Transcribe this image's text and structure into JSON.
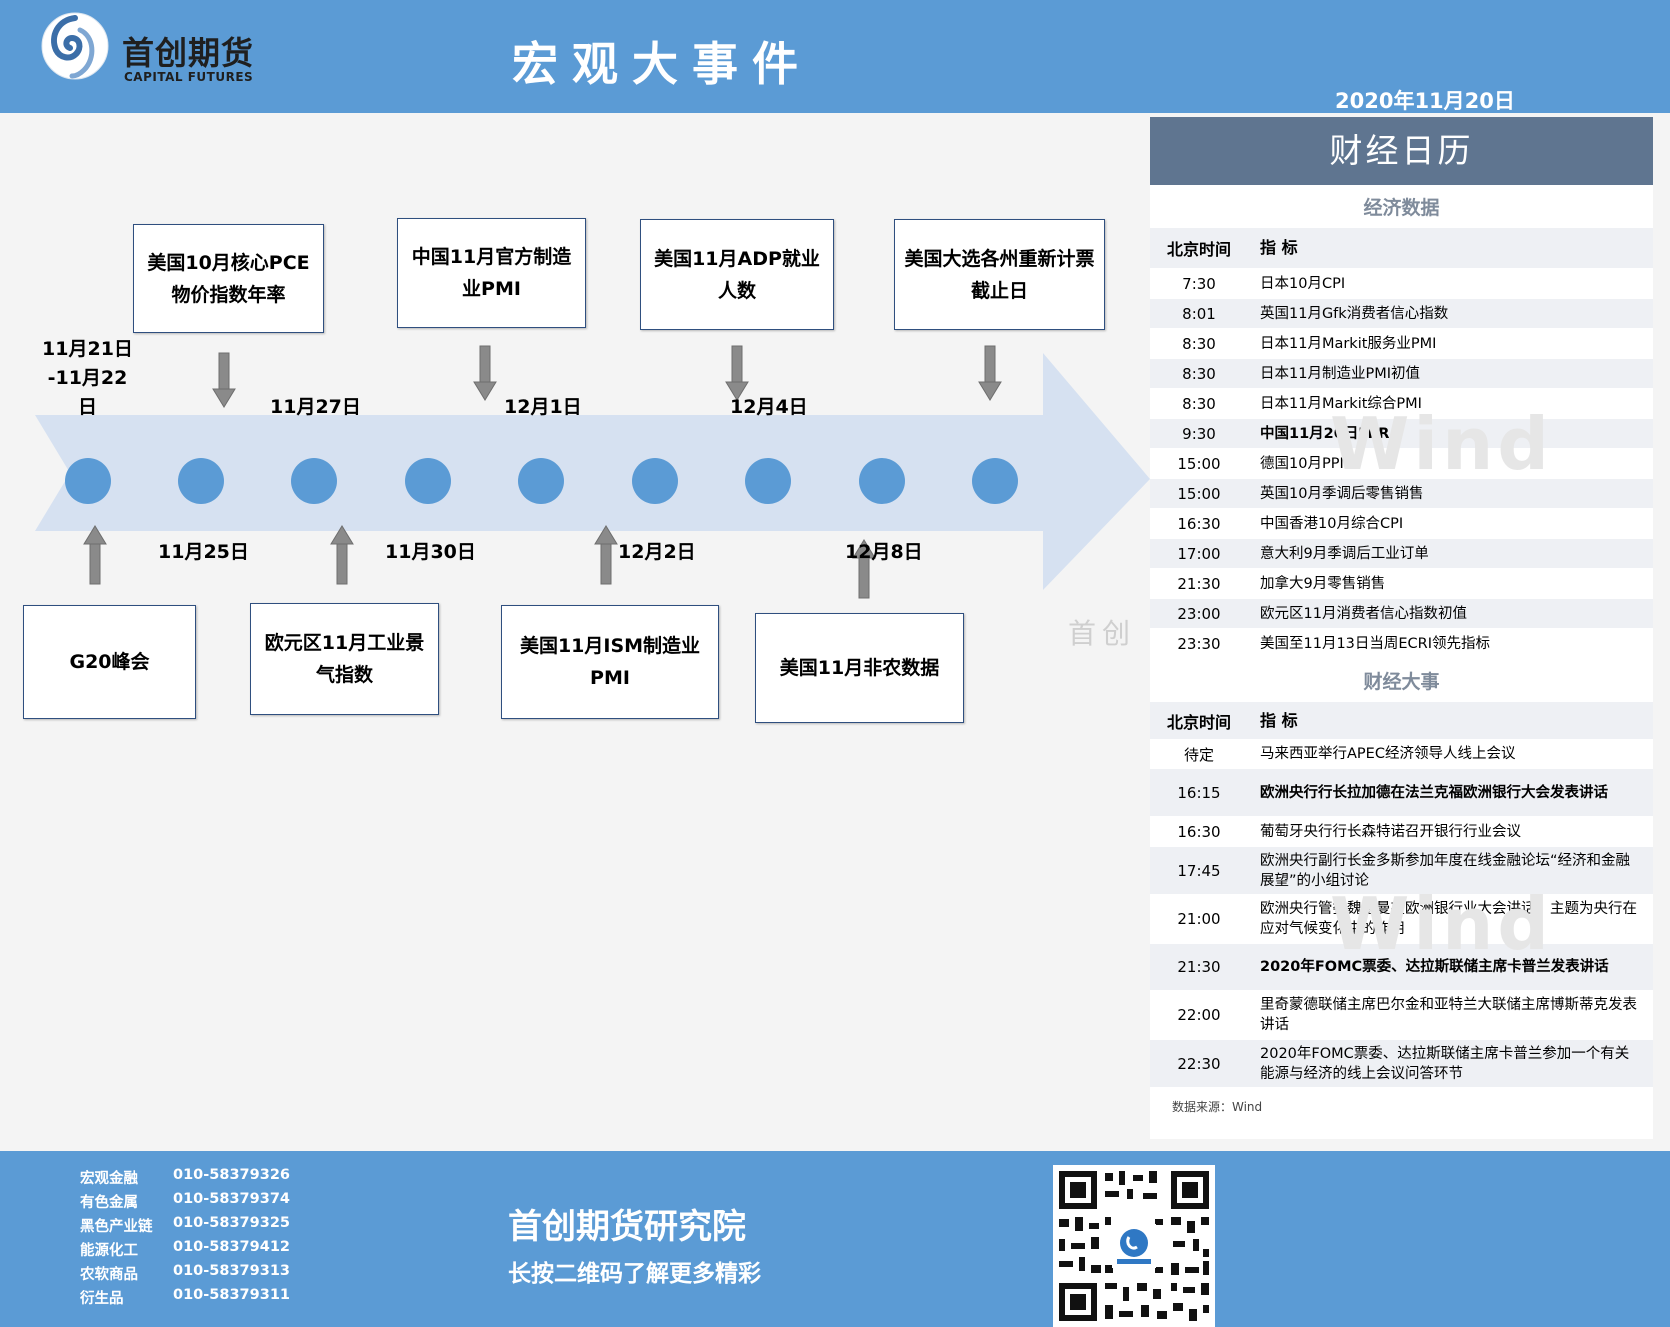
{
  "header": {
    "logo_cn": "首创期货",
    "logo_en": "CAPITAL FUTURES",
    "title": "宏观大事件",
    "date": "2020年11月20日"
  },
  "timeline": {
    "top_events": [
      {
        "l1": "美国10月核心PCE",
        "l2": "物价指数年率"
      },
      {
        "l1": "中国11月官方制造",
        "l2": "业PMI"
      },
      {
        "l1": "美国11月ADP就业",
        "l2": "人数"
      },
      {
        "l1": "美国大选各州重新计票",
        "l2": "截止日"
      }
    ],
    "bottom_events": [
      {
        "l1": "G20峰会",
        "l2": ""
      },
      {
        "l1": "欧元区11月工业景",
        "l2": "气指数"
      },
      {
        "l1": "美国11月ISM制造业",
        "l2": "PMI"
      },
      {
        "l1": "美国11月非农数据",
        "l2": ""
      }
    ],
    "first_date": {
      "l1": "11月21日",
      "l2": "-11月22",
      "l3": "日"
    },
    "top_dates": [
      "11月27日",
      "12月1日",
      "12月4日"
    ],
    "bottom_dates": [
      "11月25日",
      "11月30日",
      "12月2日",
      "12月8日"
    ]
  },
  "watermark": {
    "cn": "首创",
    "wind": "Wind"
  },
  "calendar": {
    "title": "财经日历",
    "econ_title": "经济数据",
    "events_title": "财经大事",
    "col_time": "北京时间",
    "col_indicator": "指  标",
    "econ_rows": [
      {
        "time": "7:30",
        "ind": "日本10月CPI"
      },
      {
        "time": "8:01",
        "ind": "英国11月Gfk消费者信心指数"
      },
      {
        "time": "8:30",
        "ind": "日本11月Markit服务业PMI"
      },
      {
        "time": "8:30",
        "ind": "日本11月制造业PMI初值"
      },
      {
        "time": "8:30",
        "ind": "日本11月Markit综合PMI"
      },
      {
        "time": "9:30",
        "ind": "中国11月20日LPR"
      },
      {
        "time": "15:00",
        "ind": "德国10月PPI"
      },
      {
        "time": "15:00",
        "ind": "英国10月季调后零售销售"
      },
      {
        "time": "16:30",
        "ind": "中国香港10月综合CPI"
      },
      {
        "time": "17:00",
        "ind": "意大利9月季调后工业订单"
      },
      {
        "time": "21:30",
        "ind": "加拿大9月零售销售"
      },
      {
        "time": "23:00",
        "ind": "欧元区11月消费者信心指数初值"
      },
      {
        "time": "23:30",
        "ind": "美国至11月13日当周ECRI领先指标"
      }
    ],
    "event_rows": [
      {
        "time": "待定",
        "ind": "马来西亚举行APEC经济领导人线上会议"
      },
      {
        "time": "16:15",
        "ind": "欧洲央行行长拉加德在法兰克福欧洲银行大会发表讲话"
      },
      {
        "time": "16:30",
        "ind": "葡萄牙央行行长森特诺召开银行行业会议"
      },
      {
        "time": "17:45",
        "ind": "欧洲央行副行长金多斯参加年度在线金融论坛“经济和金融展望”的小组讨论"
      },
      {
        "time": "21:00",
        "ind": "欧洲央行管委魏德曼在欧洲银行业大会讲话，主题为央行在应对气候变化中的作用"
      },
      {
        "time": "21:30",
        "ind": "2020年FOMC票委、达拉斯联储主席卡普兰发表讲话"
      },
      {
        "time": "22:00",
        "ind": "里奇蒙德联储主席巴尔金和亚特兰大联储主席博斯蒂克发表讲话"
      },
      {
        "time": "22:30",
        "ind": "2020年FOMC票委、达拉斯联储主席卡普兰参加一个有关能源与经济的线上会议问答环节"
      }
    ],
    "source": "数据来源：Wind"
  },
  "footer": {
    "contacts": [
      {
        "label": "宏观金融",
        "phone": "010-58379326"
      },
      {
        "label": "有色金属",
        "phone": "010-58379374"
      },
      {
        "label": "黑色产业链",
        "phone": "010-58379325"
      },
      {
        "label": "能源化工",
        "phone": "010-58379412"
      },
      {
        "label": "农软商品",
        "phone": "010-58379313"
      },
      {
        "label": "衍生品",
        "phone": "010-58379311"
      }
    ],
    "title": "首创期货研究院",
    "subtitle": "长按二维码了解更多精彩"
  },
  "colors": {
    "header_bg": "#5b9bd5",
    "calendar_header": "#5f7590",
    "timeline_dot": "#5b9bd5",
    "timeline_arrow": "#d6e1f1"
  }
}
